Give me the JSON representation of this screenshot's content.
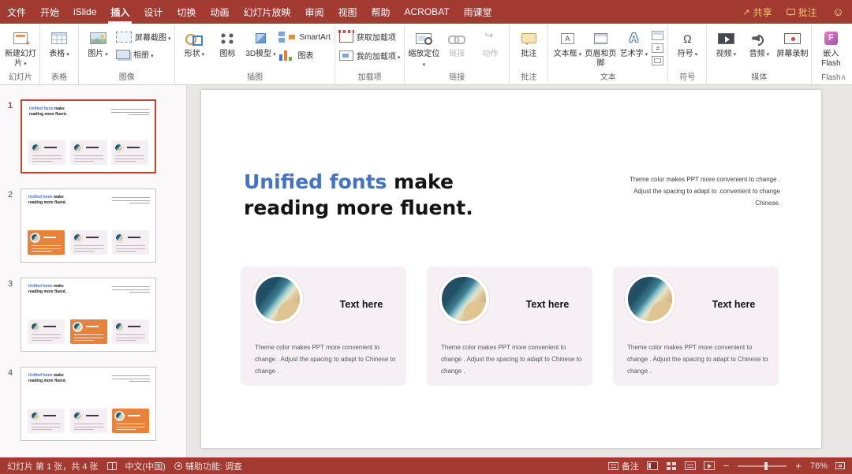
{
  "menubar": {
    "tabs": [
      "文件",
      "开始",
      "iSlide",
      "插入",
      "设计",
      "切换",
      "动画",
      "幻灯片放映",
      "审阅",
      "视图",
      "帮助",
      "ACROBAT",
      "雨课堂"
    ],
    "active_tab": "插入",
    "share_label": "共享",
    "comments_label": "批注"
  },
  "ribbon": {
    "groups": [
      {
        "label": "幻灯片",
        "buttons": [
          {
            "label": "新建幻灯片",
            "icon": "new-slide-icon",
            "dropdown": true
          }
        ]
      },
      {
        "label": "表格",
        "buttons": [
          {
            "label": "表格",
            "icon": "table-icon",
            "dropdown": true
          }
        ]
      },
      {
        "label": "图像",
        "buttons": [
          {
            "label": "图片",
            "icon": "picture-icon",
            "dropdown": true
          },
          {
            "label": "屏幕截图",
            "icon": "screenshot-icon",
            "dropdown": true
          },
          {
            "label": "相册",
            "icon": "photo-album-icon",
            "dropdown": true
          }
        ]
      },
      {
        "label": "插图",
        "buttons": [
          {
            "label": "形状",
            "icon": "shapes-icon",
            "dropdown": true
          },
          {
            "label": "图标",
            "icon": "icons-icon"
          },
          {
            "label": "3D模型",
            "icon": "3d-models-icon",
            "dropdown": true
          },
          {
            "label": "SmartArt",
            "icon": "smartart-icon"
          },
          {
            "label": "图表",
            "icon": "chart-icon"
          }
        ]
      },
      {
        "label": "加载项",
        "buttons": [
          {
            "label": "获取加载项",
            "icon": "store-icon"
          },
          {
            "label": "我的加载项",
            "icon": "my-add-ins-icon",
            "dropdown": true
          }
        ]
      },
      {
        "label": "链接",
        "buttons": [
          {
            "label": "缩放定位",
            "icon": "zoom-link-icon",
            "dropdown": true
          },
          {
            "label": "链接",
            "icon": "link-icon",
            "disabled": true
          },
          {
            "label": "动作",
            "icon": "action-icon",
            "disabled": true
          }
        ]
      },
      {
        "label": "批注",
        "buttons": [
          {
            "label": "批注",
            "icon": "comment-icon"
          }
        ]
      },
      {
        "label": "文本",
        "buttons": [
          {
            "label": "文本框",
            "icon": "text-box-icon",
            "dropdown": true
          },
          {
            "label": "页眉和页脚",
            "icon": "header-footer-icon"
          },
          {
            "label": "艺术字",
            "icon": "wordart-icon",
            "dropdown": true
          }
        ],
        "mini_icons": [
          "date-time-icon",
          "slide-number-icon",
          "object-icon"
        ]
      },
      {
        "label": "符号",
        "buttons": [
          {
            "label": "符号",
            "icon": "symbol-icon",
            "dropdown": true
          }
        ]
      },
      {
        "label": "媒体",
        "buttons": [
          {
            "label": "视频",
            "icon": "video-icon",
            "dropdown": true
          },
          {
            "label": "音频",
            "icon": "audio-icon",
            "dropdown": true
          },
          {
            "label": "屏幕录制",
            "icon": "screen-recording-icon"
          }
        ]
      },
      {
        "label": "Flash",
        "buttons": [
          {
            "label": "嵌入Flash",
            "icon": "flash-icon"
          }
        ]
      }
    ]
  },
  "sidebar": {
    "thumb_title_accent": "Unified  fonts",
    "thumb_title_rest": " make reading more fluent.",
    "slides": [
      {
        "number": "1",
        "highlight_card": -1,
        "selected": true
      },
      {
        "number": "2",
        "highlight_card": 0,
        "selected": false
      },
      {
        "number": "3",
        "highlight_card": 1,
        "selected": false
      },
      {
        "number": "4",
        "highlight_card": 2,
        "selected": false
      }
    ]
  },
  "slide": {
    "title_accent": "Unified fonts",
    "title_rest": " make reading more fluent.",
    "side_note": "Theme  color makes PPT more convenient to change . Adjust the spacing to adapt to .convenient to change  Chinese.",
    "cards": [
      {
        "title": "Text here",
        "body": "Theme  color makes PPT more convenient to change . Adjust the spacing to adapt to Chinese to change ."
      },
      {
        "title": "Text here",
        "body": "Theme  color makes PPT more convenient to change . Adjust the spacing to adapt to Chinese to change ."
      },
      {
        "title": "Text here",
        "body": "Theme  color makes PPT more convenient to change . Adjust the spacing to adapt to Chinese to change ."
      }
    ]
  },
  "statusbar": {
    "slide_counter": "幻灯片 第 1 张，共 4 张",
    "language": "中文(中国)",
    "accessibility": "辅助功能: 调查",
    "notes_label": "备注",
    "zoom_level": "76%"
  },
  "colors": {
    "accent_red": "#A23A32",
    "title_blue": "#4472C4",
    "card_bg": "#F6F0F5",
    "highlight_orange": "#E8823B",
    "share_gold": "#F6C66F"
  }
}
